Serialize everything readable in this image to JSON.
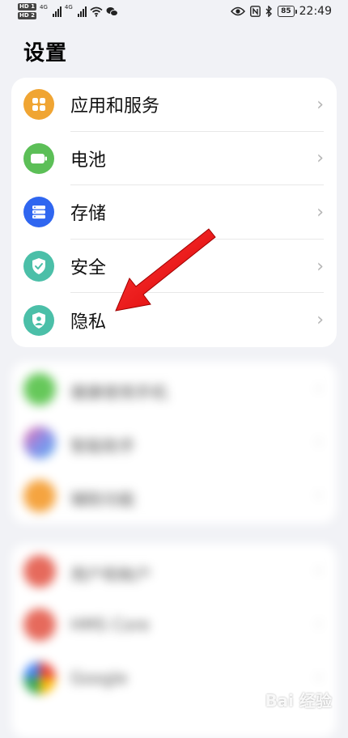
{
  "statusbar": {
    "hd1": "HD 1",
    "hd2": "HD 2",
    "net1": "4G",
    "net2": "4G",
    "battery": "85",
    "time": "22:49"
  },
  "page": {
    "title": "设置"
  },
  "settings_items": [
    {
      "label": "应用和服务",
      "icon": "apps-icon",
      "color": "#f0a533"
    },
    {
      "label": "电池",
      "icon": "battery-icon",
      "color": "#5cbf57"
    },
    {
      "label": "存储",
      "icon": "storage-icon",
      "color": "#2f66f0"
    },
    {
      "label": "安全",
      "icon": "security-shield-icon",
      "color": "#4bbfa8"
    },
    {
      "label": "隐私",
      "icon": "privacy-icon",
      "color": "#4bbfa8"
    }
  ],
  "blurred_group_1": [
    {
      "label": "健康使用手机",
      "color": "#66c85a"
    },
    {
      "label": "智能助手",
      "color": "#8a8ee8"
    },
    {
      "label": "辅助功能",
      "color": "#f5a440"
    }
  ],
  "blurred_group_2": [
    {
      "label": "用户和帐户",
      "color": "#e66a5c"
    },
    {
      "label": "HMS Core",
      "color": "#e66a5c"
    },
    {
      "label": "Google",
      "color": "#4285f4"
    }
  ],
  "chevron": "›",
  "watermark": "Bai 经验"
}
